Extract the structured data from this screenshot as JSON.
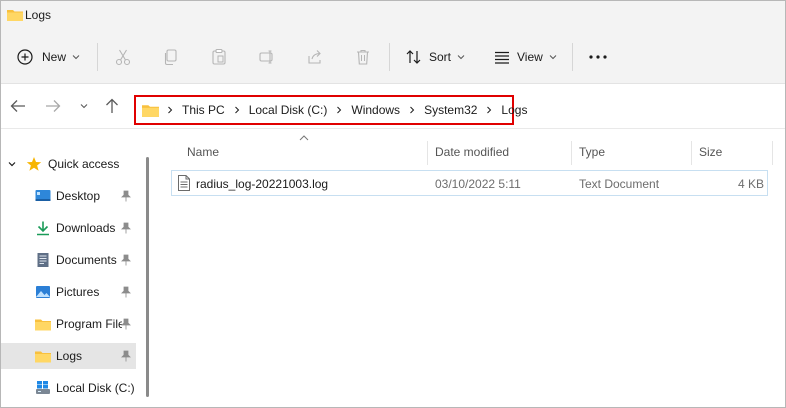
{
  "window": {
    "title": "Logs"
  },
  "toolbar": {
    "new_label": "New",
    "sort_label": "Sort",
    "view_label": "View",
    "icons": [
      "add-icon",
      "cut-icon",
      "copy-icon",
      "paste-icon",
      "rename-icon",
      "share-icon",
      "delete-icon",
      "sort-icon",
      "view-icon",
      "more-icon"
    ]
  },
  "address": {
    "crumbs": [
      "This PC",
      "Local Disk (C:)",
      "Windows",
      "System32",
      "Logs"
    ],
    "highlight_color": "#e00000"
  },
  "sidebar": {
    "quick_access_label": "Quick access",
    "items": [
      {
        "label": "Desktop",
        "icon": "desktop-icon",
        "pinned": true
      },
      {
        "label": "Downloads",
        "icon": "download-icon",
        "pinned": true
      },
      {
        "label": "Documents",
        "icon": "documents-icon",
        "pinned": true
      },
      {
        "label": "Pictures",
        "icon": "pictures-icon",
        "pinned": true
      },
      {
        "label": "Program Files",
        "icon": "folder-icon",
        "pinned": true
      },
      {
        "label": "Logs",
        "icon": "folder-icon",
        "pinned": true,
        "selected": true
      },
      {
        "label": "Local Disk (C:)",
        "icon": "drive-icon",
        "pinned": false
      }
    ]
  },
  "file_list": {
    "columns": {
      "name": "Name",
      "date": "Date modified",
      "type": "Type",
      "size": "Size"
    },
    "rows": [
      {
        "name": "radius_log-20221003.log",
        "date": "03/10/2022 5:11",
        "type": "Text Document",
        "size": "4 KB"
      }
    ]
  }
}
